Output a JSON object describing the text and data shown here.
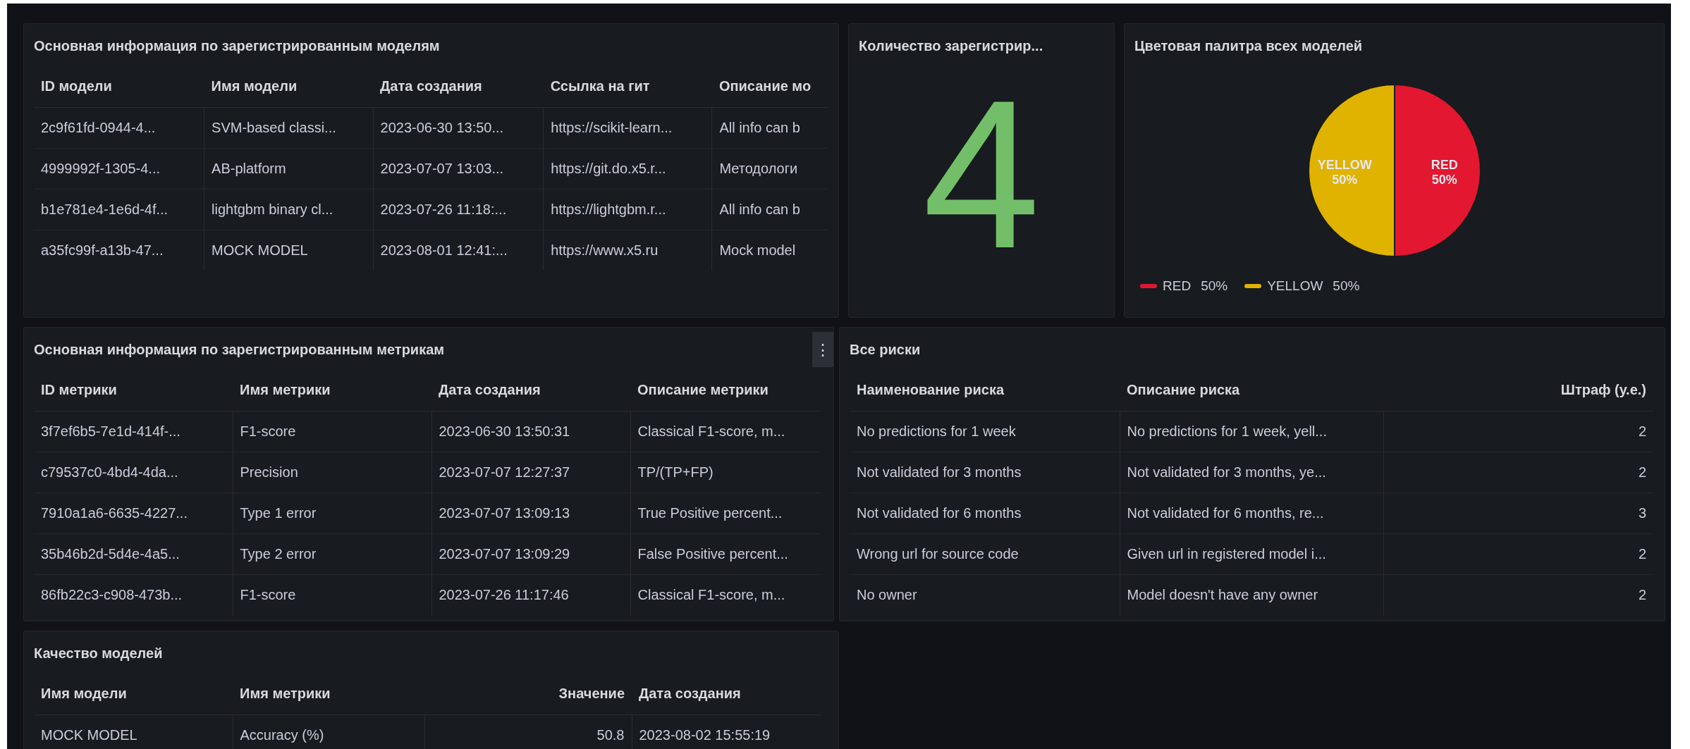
{
  "models_panel": {
    "title": "Основная информация по зарегистрированным моделям",
    "table": {
      "columns": [
        {
          "label": "ID модели",
          "right_aligned": false
        },
        {
          "label": "Имя модели",
          "right_aligned": false
        },
        {
          "label": "Дата создания",
          "right_aligned": false
        },
        {
          "label": "Ссылка на гит",
          "right_aligned": false
        },
        {
          "label": "Описание мо",
          "right_aligned": false
        }
      ],
      "rows": [
        [
          "2c9f61fd-0944-4...",
          "SVM-based classi...",
          "2023-06-30 13:50...",
          "https://scikit-learn...",
          "All info can b"
        ],
        [
          "4999992f-1305-4...",
          "AB-platform",
          "2023-07-07 13:03...",
          "https://git.do.x5.r...",
          "Методологи"
        ],
        [
          "b1e781e4-1e6d-4f...",
          "lightgbm binary cl...",
          "2023-07-26 11:18:...",
          "https://lightgbm.r...",
          "All info can b"
        ],
        [
          "a35fc99f-a13b-47...",
          "MOCK MODEL",
          "2023-08-01 12:41:...",
          "https://www.x5.ru",
          "Mock model"
        ]
      ]
    }
  },
  "count_panel": {
    "title": "Количество зарегистрир...",
    "value": "4"
  },
  "palette_panel": {
    "title": "Цветовая палитра всех моделей",
    "chart_data": {
      "type": "pie",
      "categories": [
        "YELLOW",
        "RED"
      ],
      "values": [
        50,
        50
      ],
      "value_labels": [
        "50%",
        "50%"
      ],
      "colors": [
        "#dfb300",
        "#e3172f"
      ]
    },
    "legend": [
      {
        "label": "RED",
        "percent": "50%",
        "color": "#e3172f"
      },
      {
        "label": "YELLOW",
        "percent": "50%",
        "color": "#dfb300"
      }
    ]
  },
  "metrics_panel": {
    "title": "Основная информация по зарегистрированным метрикам",
    "menu_button": "⋮",
    "table": {
      "columns": [
        {
          "label": "ID метрики",
          "right_aligned": false
        },
        {
          "label": "Имя метрики",
          "right_aligned": false
        },
        {
          "label": "Дата создания",
          "right_aligned": false
        },
        {
          "label": "Описание метрики",
          "right_aligned": false
        }
      ],
      "rows": [
        [
          "3f7ef6b5-7e1d-414f-...",
          "F1-score",
          "2023-06-30 13:50:31",
          "Classical F1-score, m..."
        ],
        [
          "c79537c0-4bd4-4da...",
          "Precision",
          "2023-07-07 12:27:37",
          "TP/(TP+FP)"
        ],
        [
          "7910a1a6-6635-4227...",
          "Type 1 error",
          "2023-07-07 13:09:13",
          "True Positive percent..."
        ],
        [
          "35b46b2d-5d4e-4a5...",
          "Type 2 error",
          "2023-07-07 13:09:29",
          "False Positive percent..."
        ],
        [
          "86fb22c3-c908-473b...",
          "F1-score",
          "2023-07-26 11:17:46",
          "Classical F1-score, m..."
        ]
      ]
    }
  },
  "risks_panel": {
    "title": "Все риски",
    "table": {
      "columns": [
        {
          "label": "Наименование риска",
          "right_aligned": false
        },
        {
          "label": "Описание риска",
          "right_aligned": false
        },
        {
          "label": "Штраф (у.е.)",
          "right_aligned": true
        }
      ],
      "rows": [
        [
          "No predictions for 1 week",
          "No predictions for 1 week, yell...",
          "2"
        ],
        [
          "Not validated for 3 months",
          "Not validated for 3 months, ye...",
          "2"
        ],
        [
          "Not validated for 6 months",
          "Not validated for 6 months, re...",
          "3"
        ],
        [
          "Wrong url for source code",
          "Given url in registered model i...",
          "2"
        ],
        [
          "No owner",
          "Model doesn't have any owner",
          "2"
        ]
      ]
    }
  },
  "quality_panel": {
    "title": "Качество моделей",
    "table": {
      "columns": [
        {
          "label": "Имя модели",
          "right_aligned": false
        },
        {
          "label": "Имя метрики",
          "right_aligned": false
        },
        {
          "label": "Значение",
          "right_aligned": true
        },
        {
          "label": "Дата создания",
          "right_aligned": false
        }
      ],
      "rows": [
        [
          "MOCK MODEL",
          "Accuracy (%)",
          "50.8",
          "2023-08-02 15:55:19"
        ]
      ]
    }
  }
}
